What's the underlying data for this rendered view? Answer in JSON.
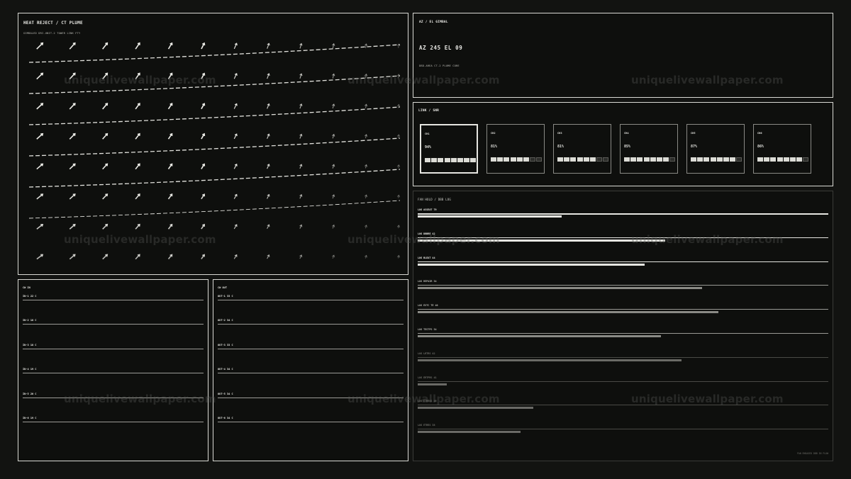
{
  "heat": {
    "title": "HEAT REJECT  /  CT PLUME",
    "subtitle": "GIMBALED DRI-UNIT-2 TOWER LINK FTY"
  },
  "gimbal": {
    "title": "AZ / EL GIMBAL",
    "readout": "AZ 245  EL 09",
    "subtitle": "DBD-AREA  CT-2  PLUME CORE"
  },
  "link": {
    "title": "LINK / SNR",
    "channels": [
      {
        "name": "CH1",
        "pct": "94%",
        "level": 8,
        "selected": true
      },
      {
        "name": "CH2",
        "pct": "81%",
        "level": 6,
        "selected": false
      },
      {
        "name": "CH3",
        "pct": "81%",
        "level": 6,
        "selected": false
      },
      {
        "name": "CH4",
        "pct": "85%",
        "level": 7,
        "selected": false
      },
      {
        "name": "CH5",
        "pct": "87%",
        "level": 7,
        "selected": false
      },
      {
        "name": "CH6",
        "pct": "86%",
        "level": 7,
        "selected": false
      }
    ]
  },
  "fan": {
    "title": "FAN  HOLD / DBB LOG",
    "rows": [
      {
        "label": "LOG ASSEAT 79",
        "value": 0.35,
        "bright": true
      },
      {
        "label": "LOG DBBRE 42",
        "value": 0.6,
        "bright": true
      },
      {
        "label": "LOG BLEAT 44",
        "value": 0.55,
        "bright": true
      },
      {
        "label": "LOG REPAIR 34",
        "value": 0.69,
        "bright": false
      },
      {
        "label": "LOG EXTC TE 40",
        "value": 0.73,
        "bright": false
      },
      {
        "label": "LOG TESTPS 34",
        "value": 0.59,
        "bright": false
      },
      {
        "label": "LOG LRTRS 42",
        "value": 0.64,
        "bright": false
      },
      {
        "label": "LOG ERTPRS 41",
        "value": 0.07,
        "bright": false
      },
      {
        "label": "LOG ETREOS 46",
        "value": 0.28,
        "bright": false
      },
      {
        "label": "LOG ETRES 38",
        "value": 0.25,
        "bright": false
      }
    ],
    "footer": "FAN ENGAGED DBB IN FLOW"
  },
  "cw_in": {
    "title": "CW IN",
    "rows": [
      "IN-1  22 C",
      "IN-2  18 C",
      "IN-3  18 C",
      "IN-4  19 C",
      "IN-5  20 C",
      "IN-6  19 C"
    ]
  },
  "cw_out": {
    "title": "CW OUT",
    "rows": [
      "OUT-1  33 C",
      "OUT-2  34 C",
      "OUT-3  33 C",
      "OUT-4  34 C",
      "OUT-5  34 C",
      "OUT-6  34 C"
    ]
  },
  "watermark": "uniquelivewallpaper.com",
  "colors": {
    "background": "#121311",
    "panel_border": "#d9d9d4",
    "text": "#e8e8e4",
    "bar_bright": "#e6e6e1",
    "bar_dim": "#7a7a75"
  }
}
